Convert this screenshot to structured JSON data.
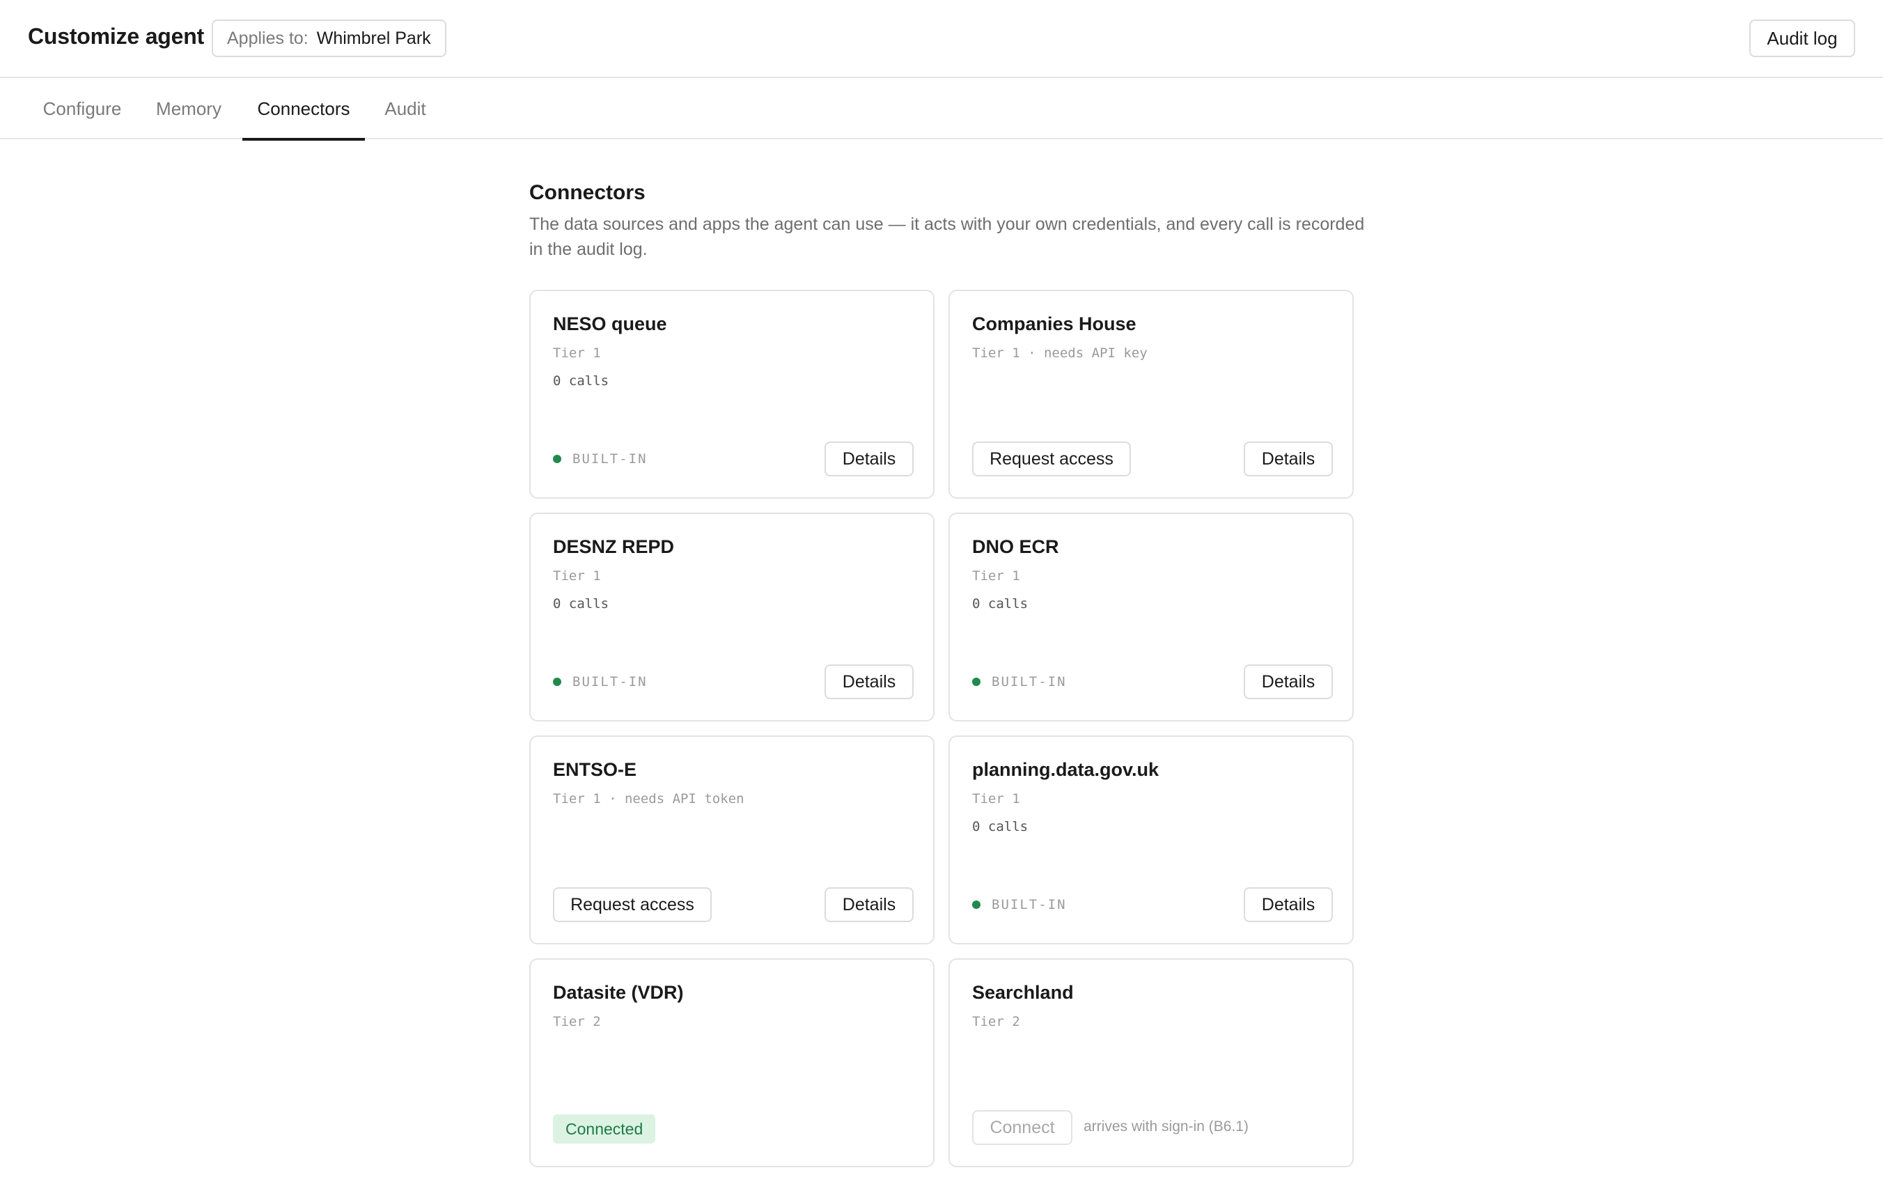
{
  "header": {
    "title": "Customize agent",
    "applies_label": "Applies to:",
    "applies_value": "Whimbrel Park",
    "audit_log": "Audit log"
  },
  "tabs": [
    {
      "label": "Configure",
      "active": false
    },
    {
      "label": "Memory",
      "active": false
    },
    {
      "label": "Connectors",
      "active": true
    },
    {
      "label": "Audit",
      "active": false
    }
  ],
  "section": {
    "title": "Connectors",
    "description": "The data sources and apps the agent can use — it acts with your own credentials, and every call is recorded in the audit log."
  },
  "colors": {
    "builtin_dot": "#1f8a4c",
    "connected_bg": "#dcf3e4",
    "connected_text": "#1d7a43"
  },
  "connectors": [
    {
      "name": "NESO queue",
      "tier": "Tier 1",
      "calls": "0 calls",
      "status": "BUILT-IN",
      "details": "Details"
    },
    {
      "name": "Companies House",
      "tier": "Tier 1 · needs API key",
      "action": "Request access",
      "details": "Details"
    },
    {
      "name": "DESNZ REPD",
      "tier": "Tier 1",
      "calls": "0 calls",
      "status": "BUILT-IN",
      "details": "Details"
    },
    {
      "name": "DNO ECR",
      "tier": "Tier 1",
      "calls": "0 calls",
      "status": "BUILT-IN",
      "details": "Details"
    },
    {
      "name": "ENTSO-E",
      "tier": "Tier 1 · needs API token",
      "action": "Request access",
      "details": "Details"
    },
    {
      "name": "planning.data.gov.uk",
      "tier": "Tier 1",
      "calls": "0 calls",
      "status": "BUILT-IN",
      "details": "Details"
    },
    {
      "name": "Datasite (VDR)",
      "tier": "Tier 2",
      "badge": "Connected"
    },
    {
      "name": "Searchland",
      "tier": "Tier 2",
      "action": "Connect",
      "note": "arrives with sign-in (B6.1)"
    }
  ]
}
